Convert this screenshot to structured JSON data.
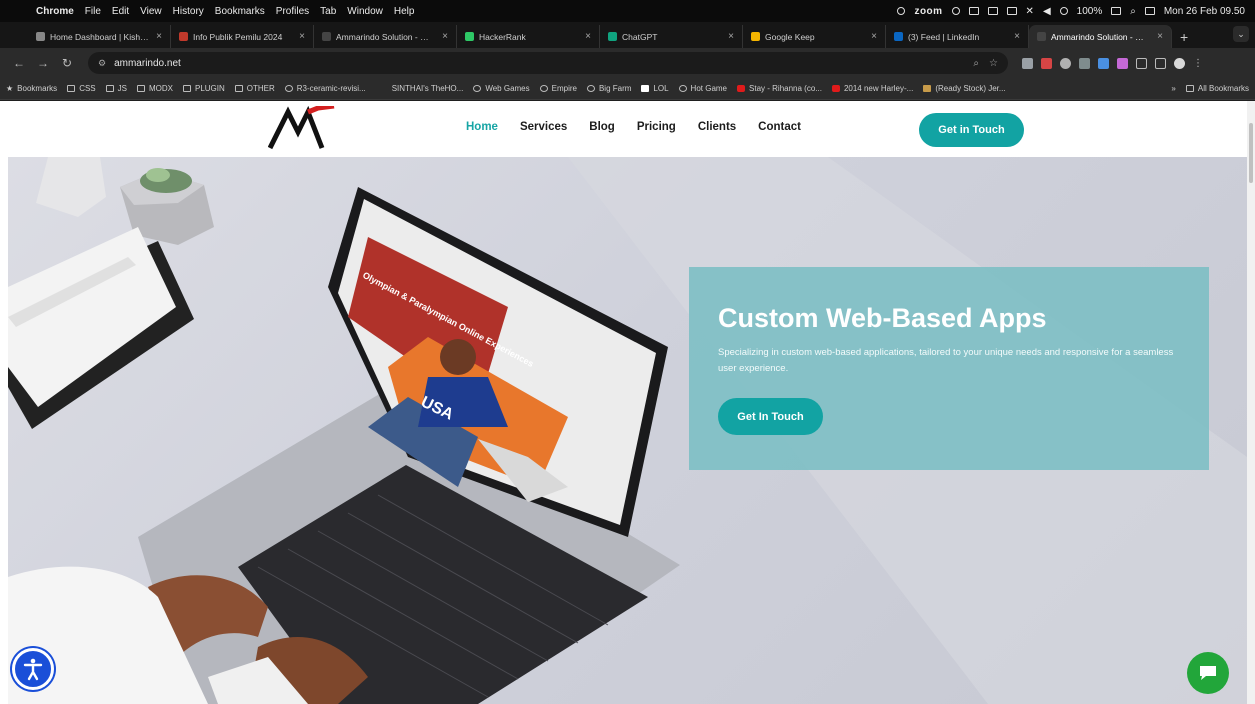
{
  "menubar": {
    "app": "Chrome",
    "items": [
      "File",
      "Edit",
      "View",
      "History",
      "Bookmarks",
      "Profiles",
      "Tab",
      "Window",
      "Help"
    ],
    "zoom": "zoom",
    "battery": "100%",
    "datetime": "Mon 26 Feb 09.50"
  },
  "tabs": [
    {
      "title": "Home Dashboard | Kisha-A...",
      "color": "#888888"
    },
    {
      "title": "Info Publik Pemilu 2024",
      "color": "#c0392b"
    },
    {
      "title": "Ammarindo Solution - Web...",
      "color": "#444444"
    },
    {
      "title": "HackerRank",
      "color": "#2ec866"
    },
    {
      "title": "ChatGPT",
      "color": "#10a37f"
    },
    {
      "title": "Google Keep",
      "color": "#f4b400"
    },
    {
      "title": "(3) Feed | LinkedIn",
      "color": "#0a66c2"
    },
    {
      "title": "Ammarindo Solution - Web...",
      "color": "#444444",
      "active": true
    }
  ],
  "toolbar": {
    "url": "ammarindo.net"
  },
  "bookmarks": {
    "items": [
      {
        "label": "Bookmarks",
        "icon": "star-icon"
      },
      {
        "label": "CSS",
        "icon": "folder-icon"
      },
      {
        "label": "JS",
        "icon": "folder-icon"
      },
      {
        "label": "MODX",
        "icon": "folder-icon"
      },
      {
        "label": "PLUGIN",
        "icon": "folder-icon"
      },
      {
        "label": "OTHER",
        "icon": "folder-icon"
      },
      {
        "label": "R3-ceramic-revisi...",
        "icon": "globe-icon"
      },
      {
        "label": "SINTHAI's TheHO...",
        "icon": "none"
      },
      {
        "label": "Web Games",
        "icon": "globe-icon"
      },
      {
        "label": "Empire",
        "icon": "globe-icon"
      },
      {
        "label": "Big Farm",
        "icon": "globe-icon"
      },
      {
        "label": "LOL",
        "icon": "page-icon"
      },
      {
        "label": "Hot Game",
        "icon": "globe-icon"
      },
      {
        "label": "Stay - Rihanna (co...",
        "icon": "youtube-icon"
      },
      {
        "label": "2014 new Harley-...",
        "icon": "youtube-icon"
      },
      {
        "label": "(Ready Stock) Jer...",
        "icon": "image-icon"
      }
    ],
    "more": "»",
    "all": "All Bookmarks"
  },
  "site": {
    "nav": [
      "Home",
      "Services",
      "Blog",
      "Pricing",
      "Clients",
      "Contact"
    ],
    "cta": "Get in Touch",
    "hero": {
      "title": "Custom Web-Based Apps",
      "subtitle": "Specializing in custom web-based applications, tailored to your unique needs and responsive for a seamless user experience.",
      "button": "Get In Touch"
    },
    "laptop_screen": {
      "headline": "Olympian & Paralympian Online Experiences",
      "shirt": "USA"
    }
  },
  "colors": {
    "accent": "#12a3a3",
    "hero_card": "#7dbfc4",
    "nav_active": "#17a5a5",
    "accessibility": "#1a4fd8",
    "chat": "#22a63a"
  }
}
